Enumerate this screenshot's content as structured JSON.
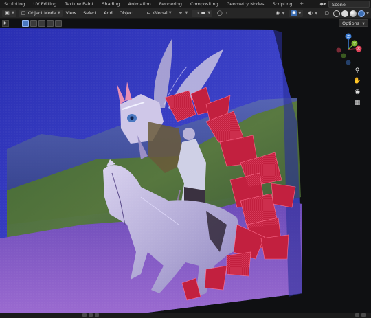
{
  "workspace_tabs": [
    "Sculpting",
    "UV Editing",
    "Texture Paint",
    "Shading",
    "Animation",
    "Rendering",
    "Compositing",
    "Geometry Nodes",
    "Scripting"
  ],
  "workspace_add": "+",
  "scene": {
    "label": "Scene"
  },
  "view_header": {
    "mode": "Object Mode",
    "menus": [
      "View",
      "Select",
      "Add",
      "Object"
    ],
    "transform_orientation": "Global"
  },
  "tool_header": {
    "options_label": "Options"
  },
  "navigation": {
    "axes": {
      "x": "X",
      "y": "Y",
      "z": "Z"
    },
    "tools": [
      "zoom",
      "pan",
      "camera",
      "grid"
    ]
  },
  "colors": {
    "accent": "#3d6fb3",
    "axis_x": "#e0445a",
    "axis_y": "#7fb62f",
    "axis_z": "#3f7fd6",
    "sky": "#3a3fc4",
    "crystal_red": "#d1244a"
  }
}
